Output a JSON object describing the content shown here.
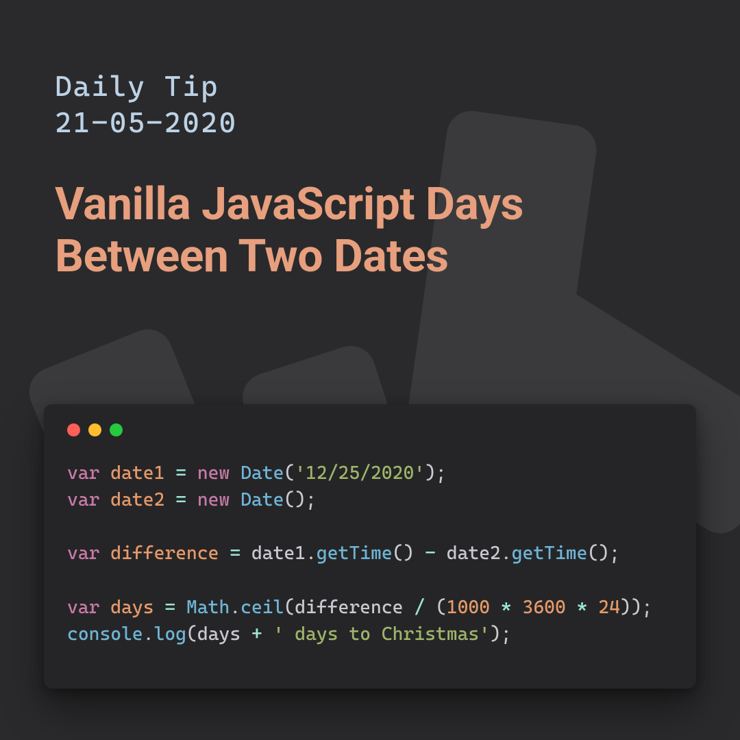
{
  "header": {
    "subtitle_line1": "Daily Tip",
    "subtitle_line2": "21-05-2020",
    "title": "Vanilla JavaScript Days Between Two Dates"
  },
  "window": {
    "dots": [
      "red",
      "yellow",
      "green"
    ]
  },
  "code": {
    "tokens": [
      [
        {
          "t": "var ",
          "c": "tok-key"
        },
        {
          "t": "date1 ",
          "c": "tok-var"
        },
        {
          "t": "= ",
          "c": "tok-op"
        },
        {
          "t": "new ",
          "c": "tok-new"
        },
        {
          "t": "Date",
          "c": "tok-cls"
        },
        {
          "t": "(",
          "c": "tok-id"
        },
        {
          "t": "'12/25/2020'",
          "c": "tok-str"
        },
        {
          "t": ");",
          "c": "tok-id"
        }
      ],
      [
        {
          "t": "var ",
          "c": "tok-key"
        },
        {
          "t": "date2 ",
          "c": "tok-var"
        },
        {
          "t": "= ",
          "c": "tok-op"
        },
        {
          "t": "new ",
          "c": "tok-new"
        },
        {
          "t": "Date",
          "c": "tok-cls"
        },
        {
          "t": "();",
          "c": "tok-id"
        }
      ],
      [],
      [
        {
          "t": "var ",
          "c": "tok-key"
        },
        {
          "t": "difference ",
          "c": "tok-var"
        },
        {
          "t": "= ",
          "c": "tok-op"
        },
        {
          "t": "date1",
          "c": "tok-id"
        },
        {
          "t": ".",
          "c": "tok-id"
        },
        {
          "t": "getTime",
          "c": "tok-func"
        },
        {
          "t": "() ",
          "c": "tok-id"
        },
        {
          "t": "- ",
          "c": "tok-op"
        },
        {
          "t": "date2",
          "c": "tok-id"
        },
        {
          "t": ".",
          "c": "tok-id"
        },
        {
          "t": "getTime",
          "c": "tok-func"
        },
        {
          "t": "();",
          "c": "tok-id"
        }
      ],
      [],
      [
        {
          "t": "var ",
          "c": "tok-key"
        },
        {
          "t": "days ",
          "c": "tok-var"
        },
        {
          "t": "= ",
          "c": "tok-op"
        },
        {
          "t": "Math",
          "c": "tok-cls"
        },
        {
          "t": ".",
          "c": "tok-id"
        },
        {
          "t": "ceil",
          "c": "tok-func"
        },
        {
          "t": "(",
          "c": "tok-id"
        },
        {
          "t": "difference ",
          "c": "tok-id"
        },
        {
          "t": "/ ",
          "c": "tok-op"
        },
        {
          "t": "(",
          "c": "tok-id"
        },
        {
          "t": "1000 ",
          "c": "tok-num"
        },
        {
          "t": "* ",
          "c": "tok-op"
        },
        {
          "t": "3600 ",
          "c": "tok-num"
        },
        {
          "t": "* ",
          "c": "tok-op"
        },
        {
          "t": "24",
          "c": "tok-num"
        },
        {
          "t": "));",
          "c": "tok-id"
        }
      ],
      [
        {
          "t": "console",
          "c": "tok-cls"
        },
        {
          "t": ".",
          "c": "tok-id"
        },
        {
          "t": "log",
          "c": "tok-func"
        },
        {
          "t": "(",
          "c": "tok-id"
        },
        {
          "t": "days ",
          "c": "tok-id"
        },
        {
          "t": "+ ",
          "c": "tok-op"
        },
        {
          "t": "' days to Christmas'",
          "c": "tok-str"
        },
        {
          "t": ");",
          "c": "tok-id"
        }
      ]
    ]
  }
}
